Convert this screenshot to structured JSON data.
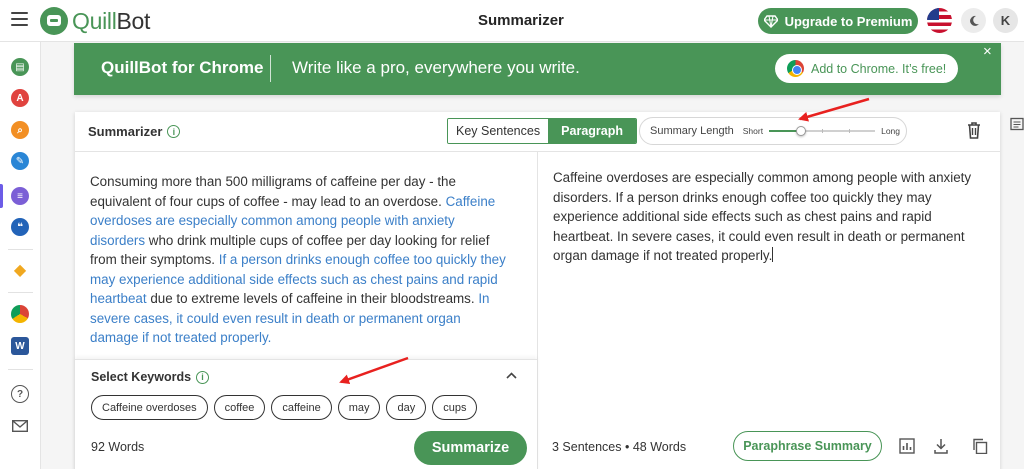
{
  "header": {
    "brand_prefix": "Quill",
    "brand_suffix": "Bot",
    "page_title": "Summarizer",
    "upgrade_label": "Upgrade to Premium",
    "avatar_initial": "K"
  },
  "banner": {
    "title": "QuillBot for Chrome",
    "tagline": "Write like a pro, everywhere you write.",
    "button_label": "Add to Chrome. It’s free!",
    "close_symbol": "×"
  },
  "summarizer": {
    "title": "Summarizer",
    "modes": [
      "Key Sentences",
      "Paragraph"
    ],
    "active_mode": "Paragraph",
    "length_label": "Summary Length",
    "length_min_label": "Short",
    "length_max_label": "Long",
    "length_value": 0.3
  },
  "input": {
    "segments": [
      {
        "text": "Consuming more than 500 milligrams of caffeine per day - the equivalent of four cups of coffee - may lead to an overdose. ",
        "highlight": false
      },
      {
        "text": "Caffeine overdoses are especially common among people with anxiety disorders",
        "highlight": true
      },
      {
        "text": " who drink multiple cups of coffee per day looking for relief from their symptoms. ",
        "highlight": false
      },
      {
        "text": "If a person drinks enough coffee too quickly they may experience additional side effects such as chest pains and rapid heartbeat",
        "highlight": true
      },
      {
        "text": " due to extreme levels of caffeine in their bloodstreams. ",
        "highlight": false
      },
      {
        "text": "In severe cases, it could even result in death or permanent organ damage if not treated properly.",
        "highlight": true
      }
    ],
    "keywords_title": "Select Keywords",
    "keywords": [
      "Caffeine overdoses",
      "coffee",
      "caffeine",
      "may",
      "day",
      "cups"
    ],
    "word_count": "92 Words",
    "summarize_label": "Summarize"
  },
  "output": {
    "text": "Caffeine overdoses are especially common among people with anxiety disorders. If a person drinks enough coffee too quickly they may experience additional side effects such as chest pains and rapid heartbeat. In severe cases, it could even result in death or permanent organ damage if not treated properly.",
    "stats": "3 Sentences • 48 Words",
    "paraphrase_label": "Paraphrase Summary"
  },
  "colors": {
    "brand_green": "#499557",
    "highlight_blue": "#3b7fc8",
    "annotation_red": "#e8211f"
  },
  "icons": [
    "menu-icon",
    "diamond-icon",
    "moon-icon",
    "info-icon",
    "trash-icon",
    "chevron-up-icon",
    "bar-chart-icon",
    "download-icon",
    "copy-icon",
    "chrome-icon",
    "help-icon",
    "mail-icon"
  ]
}
